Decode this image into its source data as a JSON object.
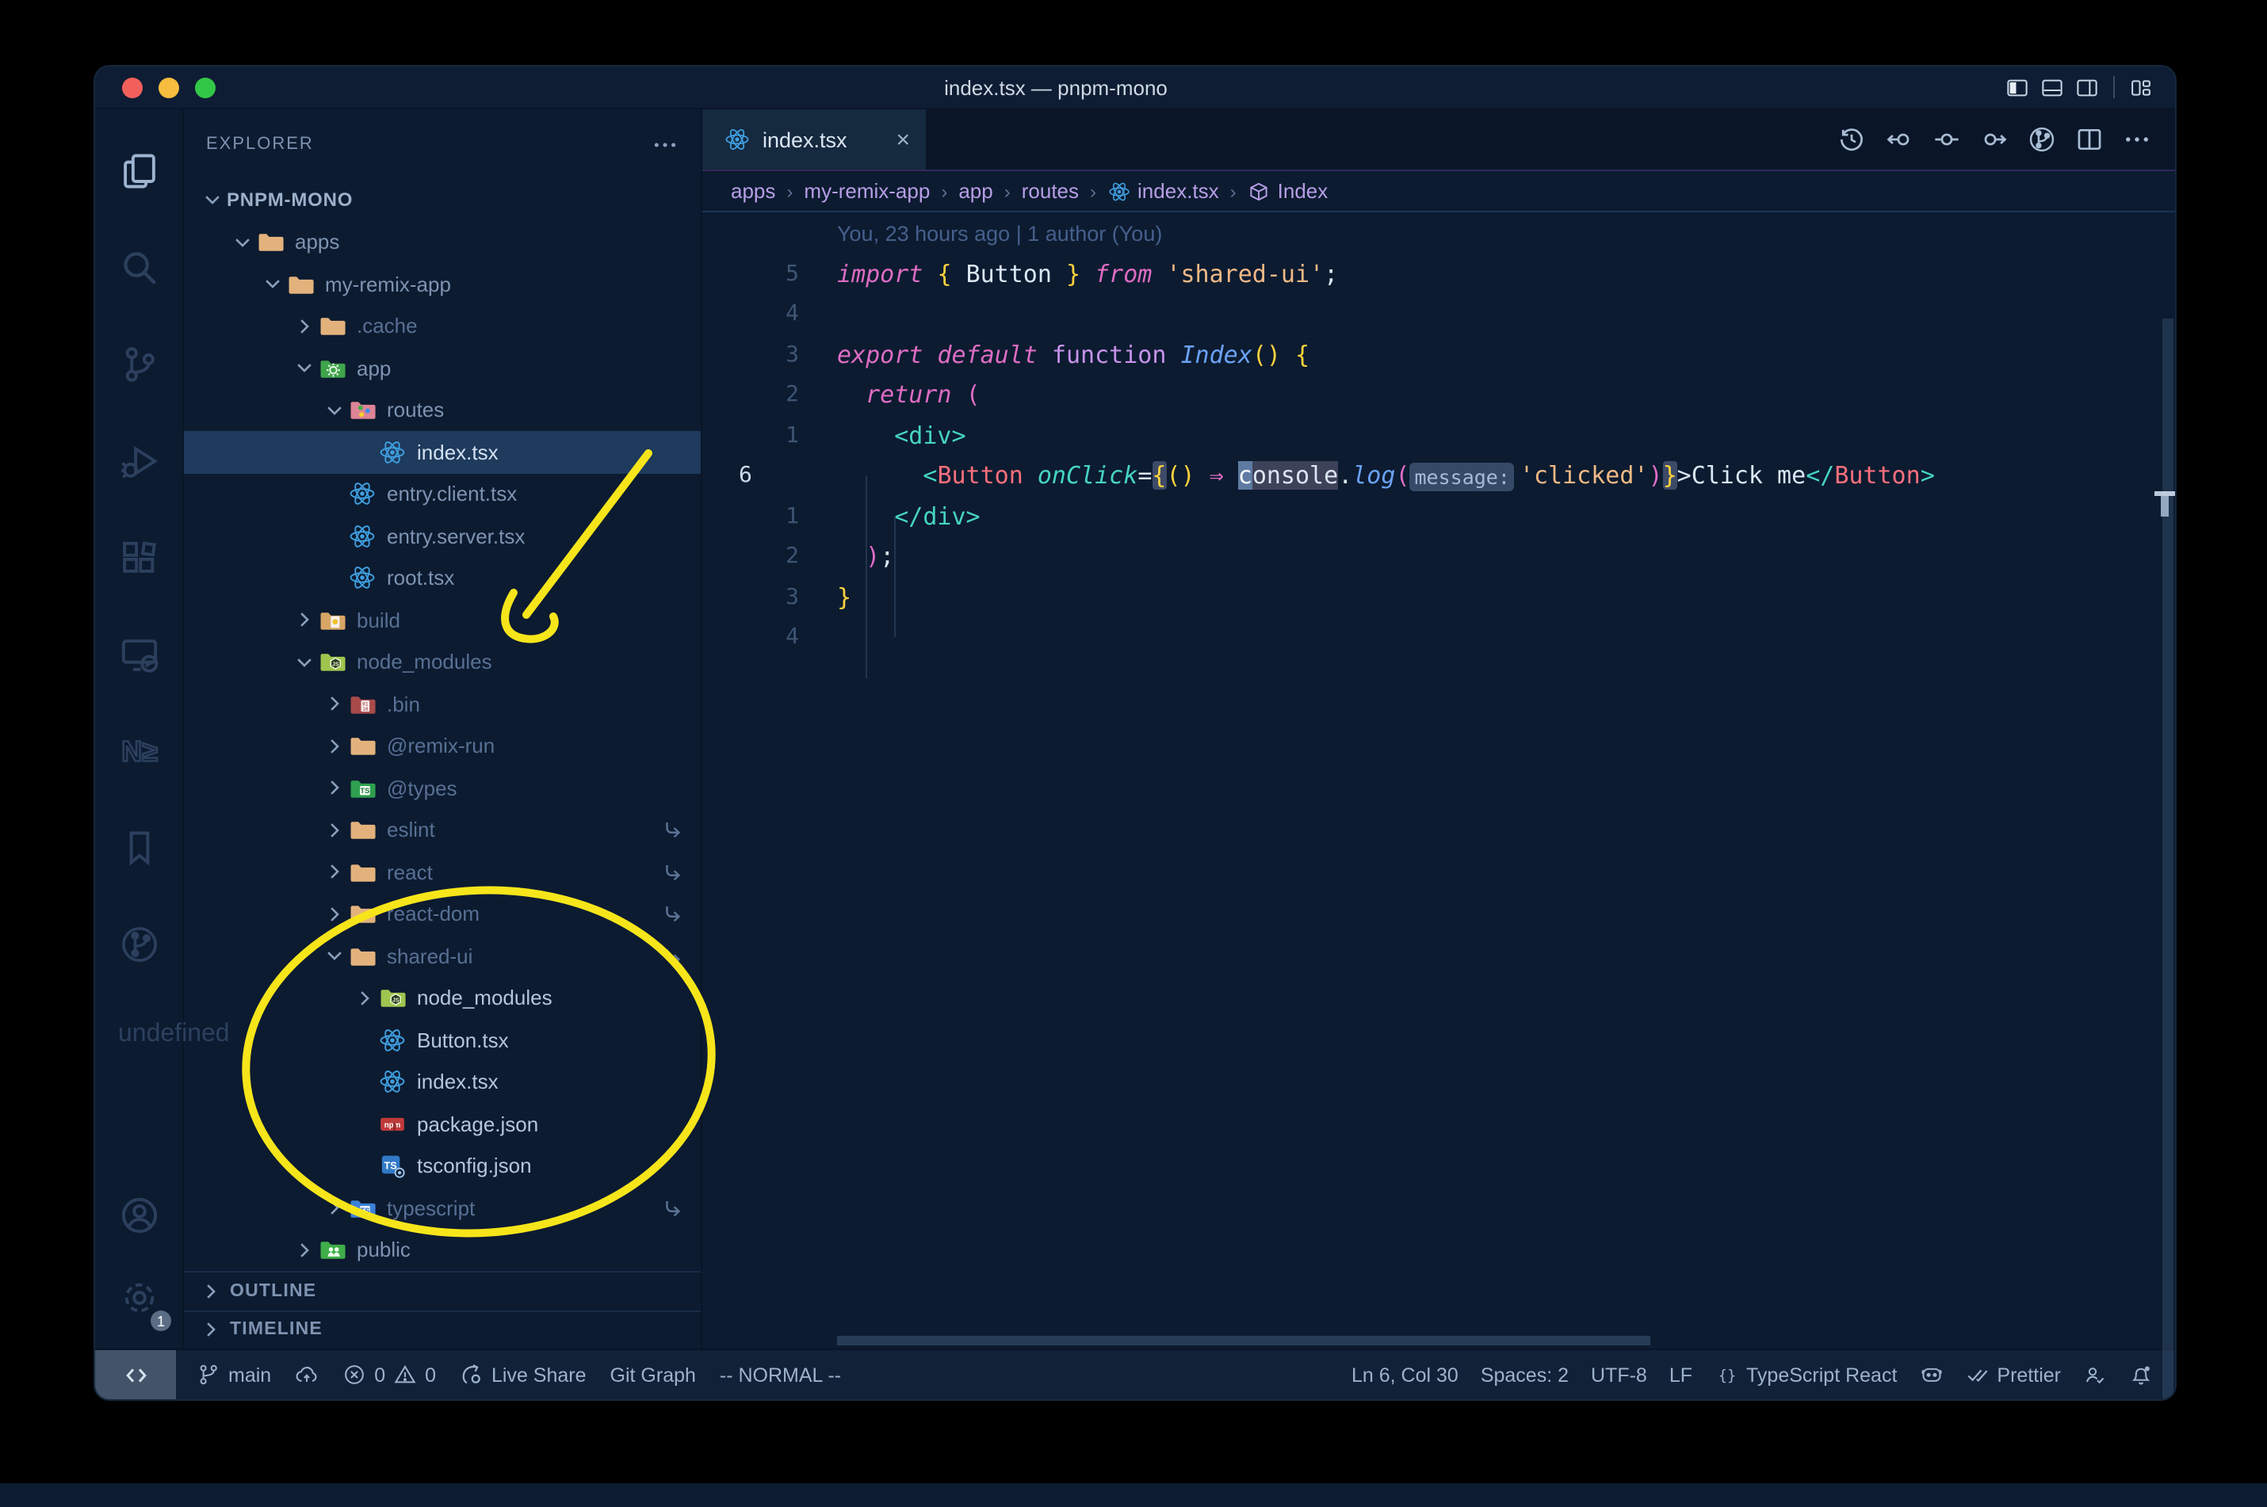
{
  "window": {
    "title": "index.tsx — pnpm-mono"
  },
  "titlebar": {
    "traffic_lights": [
      "close",
      "minimize",
      "zoom"
    ],
    "layout_actions": [
      "toggle-sidebar",
      "toggle-panel",
      "toggle-secondary-sidebar",
      "separator",
      "customize-layout"
    ]
  },
  "activity_bar": {
    "top": [
      {
        "name": "explorer",
        "icon": "files",
        "active": true
      },
      {
        "name": "search",
        "icon": "search",
        "active": false
      },
      {
        "name": "source-control",
        "icon": "scm",
        "active": false
      },
      {
        "name": "run-debug",
        "icon": "debug",
        "active": false
      },
      {
        "name": "extensions",
        "icon": "extensions",
        "active": false
      },
      {
        "name": "remote-explorer",
        "icon": "remote-explorer",
        "active": false
      },
      {
        "name": "nx-console",
        "icon": "nx",
        "active": false
      },
      {
        "name": "bookmarks",
        "icon": "bookmark",
        "active": false
      },
      {
        "name": "git-graph",
        "icon": "graph-circle",
        "active": false
      },
      {
        "name": "more-views",
        "icon": "ellipsis",
        "active": false
      }
    ],
    "bottom": [
      {
        "name": "accounts",
        "icon": "account",
        "badge": ""
      },
      {
        "name": "settings",
        "icon": "gear",
        "badge": "1"
      }
    ]
  },
  "explorer": {
    "header": "EXPLORER",
    "root": {
      "label": "PNPM-MONO",
      "chevron": "down"
    },
    "items": [
      {
        "label": "apps",
        "icon": "folder-tan",
        "level": 1,
        "chevron": "down",
        "tone": "normal"
      },
      {
        "label": "my-remix-app",
        "icon": "folder-tan",
        "level": 2,
        "chevron": "down",
        "tone": "normal"
      },
      {
        "label": ".cache",
        "icon": "folder-tan",
        "level": 3,
        "chevron": "right",
        "tone": "dim"
      },
      {
        "label": "app",
        "icon": "folder-app",
        "level": 3,
        "chevron": "down",
        "tone": "normal"
      },
      {
        "label": "routes",
        "icon": "folder-routes",
        "level": 4,
        "chevron": "down",
        "tone": "normal"
      },
      {
        "label": "index.tsx",
        "icon": "react",
        "level": 5,
        "chevron": null,
        "tone": "bright",
        "selected": true
      },
      {
        "label": "entry.client.tsx",
        "icon": "react",
        "level": 4,
        "chevron": null,
        "tone": "normal"
      },
      {
        "label": "entry.server.tsx",
        "icon": "react",
        "level": 4,
        "chevron": null,
        "tone": "normal"
      },
      {
        "label": "root.tsx",
        "icon": "react",
        "level": 4,
        "chevron": null,
        "tone": "normal"
      },
      {
        "label": "build",
        "icon": "folder-build",
        "level": 3,
        "chevron": "right",
        "tone": "dim"
      },
      {
        "label": "node_modules",
        "icon": "folder-nm",
        "level": 3,
        "chevron": "down",
        "tone": "dim"
      },
      {
        "label": ".bin",
        "icon": "folder-bin",
        "level": 4,
        "chevron": "right",
        "tone": "dim"
      },
      {
        "label": "@remix-run",
        "icon": "folder-tan",
        "level": 4,
        "chevron": "right",
        "tone": "dim"
      },
      {
        "label": "@types",
        "icon": "folder-types",
        "level": 4,
        "chevron": "right",
        "tone": "dim"
      },
      {
        "label": "eslint",
        "icon": "folder-tan",
        "level": 4,
        "chevron": "right",
        "tone": "dim",
        "symlink": true
      },
      {
        "label": "react",
        "icon": "folder-tan",
        "level": 4,
        "chevron": "right",
        "tone": "dim",
        "symlink": true
      },
      {
        "label": "react-dom",
        "icon": "folder-tan",
        "level": 4,
        "chevron": "right",
        "tone": "dim",
        "symlink": true
      },
      {
        "label": "shared-ui",
        "icon": "folder-tan",
        "level": 4,
        "chevron": "down",
        "tone": "dim",
        "symlink": true
      },
      {
        "label": "node_modules",
        "icon": "folder-nm",
        "level": 5,
        "chevron": "right",
        "tone": "bright"
      },
      {
        "label": "Button.tsx",
        "icon": "react",
        "level": 5,
        "chevron": null,
        "tone": "bright"
      },
      {
        "label": "index.tsx",
        "icon": "react",
        "level": 5,
        "chevron": null,
        "tone": "bright"
      },
      {
        "label": "package.json",
        "icon": "npm",
        "level": 5,
        "chevron": null,
        "tone": "bright"
      },
      {
        "label": "tsconfig.json",
        "icon": "tsconfig",
        "level": 5,
        "chevron": null,
        "tone": "bright"
      },
      {
        "label": "typescript",
        "icon": "folder-tsblue",
        "level": 4,
        "chevron": "right",
        "tone": "dim",
        "symlink": true
      },
      {
        "label": "public",
        "icon": "folder-public",
        "level": 3,
        "chevron": "right",
        "tone": "normal"
      }
    ],
    "sections": [
      "OUTLINE",
      "TIMELINE"
    ]
  },
  "tabs": [
    {
      "label": "index.tsx",
      "icon": "react",
      "active": true,
      "close_icon": "×"
    }
  ],
  "editor_actions": [
    "history",
    "nav-back",
    "nav-current",
    "nav-forward",
    "gitlens-graph",
    "split-editor",
    "more-actions"
  ],
  "breadcrumbs": [
    {
      "label": "apps"
    },
    {
      "label": "my-remix-app"
    },
    {
      "label": "app"
    },
    {
      "label": "routes"
    },
    {
      "label": "index.tsx",
      "icon": "react"
    },
    {
      "label": "Index",
      "icon": "symbol-module"
    }
  ],
  "editor": {
    "blame": "You, 23 hours ago | 1 author (You)",
    "lines": [
      {
        "n": "5",
        "active": false,
        "tokens": [
          [
            "import",
            "k"
          ],
          [
            " ",
            ""
          ],
          [
            "{",
            "y"
          ],
          [
            " ",
            ""
          ],
          [
            "Button",
            "w"
          ],
          [
            " ",
            ""
          ],
          [
            "}",
            "y"
          ],
          [
            " ",
            ""
          ],
          [
            "from",
            "k"
          ],
          [
            " ",
            ""
          ],
          [
            "'shared-ui'",
            "s"
          ],
          [
            ";",
            "w"
          ]
        ]
      },
      {
        "n": "4",
        "active": false,
        "tokens": []
      },
      {
        "n": "3",
        "active": false,
        "tokens": [
          [
            "export",
            "k"
          ],
          [
            " ",
            ""
          ],
          [
            "default",
            "k"
          ],
          [
            " ",
            ""
          ],
          [
            "function",
            "k2"
          ],
          [
            " ",
            ""
          ],
          [
            "Index",
            "fn"
          ],
          [
            "(",
            "y"
          ],
          [
            ")",
            "y"
          ],
          [
            " ",
            ""
          ],
          [
            "{",
            "y"
          ]
        ]
      },
      {
        "n": "2",
        "active": false,
        "tokens": [
          [
            "  ",
            ""
          ],
          [
            "return",
            "k"
          ],
          [
            " ",
            ""
          ],
          [
            "(",
            "p"
          ]
        ]
      },
      {
        "n": "1",
        "active": false,
        "tokens": [
          [
            "    ",
            ""
          ],
          [
            "<div>",
            "t"
          ]
        ]
      },
      {
        "n": "6",
        "active": true,
        "tokens": [
          [
            "      ",
            ""
          ],
          [
            "<",
            "t"
          ],
          [
            "Button",
            "tag"
          ],
          [
            " ",
            ""
          ],
          [
            "onClick",
            "attr"
          ],
          [
            "=",
            "w"
          ],
          [
            "{",
            "ybox"
          ],
          [
            "(",
            "y"
          ],
          [
            ")",
            "y"
          ],
          [
            " ",
            ""
          ],
          [
            "⇒",
            "p"
          ],
          [
            " ",
            ""
          ],
          [
            "c",
            "cur"
          ],
          [
            "onsole",
            "hl"
          ],
          [
            ".",
            "w"
          ],
          [
            "log",
            "fn"
          ],
          [
            "(",
            "p"
          ],
          [
            "message:",
            "inlay"
          ],
          [
            "'clicked'",
            "s"
          ],
          [
            ")",
            "p"
          ],
          [
            "}",
            "ybox"
          ],
          [
            ">",
            "w"
          ],
          [
            "Click me",
            "w"
          ],
          [
            "</",
            "t"
          ],
          [
            "Button",
            "tag"
          ],
          [
            ">",
            "t"
          ]
        ]
      },
      {
        "n": "1",
        "active": false,
        "tokens": [
          [
            "    ",
            ""
          ],
          [
            "</div>",
            "t"
          ]
        ]
      },
      {
        "n": "2",
        "active": false,
        "tokens": [
          [
            "  ",
            ""
          ],
          [
            ")",
            "p"
          ],
          [
            ";",
            "w"
          ]
        ]
      },
      {
        "n": "3",
        "active": false,
        "tokens": [
          [
            "}",
            "y"
          ]
        ]
      },
      {
        "n": "4",
        "active": false,
        "tokens": []
      }
    ]
  },
  "status_bar": {
    "left": [
      {
        "name": "remote-indicator",
        "icon": "remote",
        "block": true
      },
      {
        "name": "git-branch",
        "icon": "branch",
        "label": "main"
      },
      {
        "name": "sync",
        "icon": "cloud-up",
        "label": ""
      },
      {
        "name": "problems",
        "composite": [
          [
            "error",
            "0"
          ],
          [
            "warning",
            "0"
          ]
        ]
      },
      {
        "name": "live-share",
        "icon": "liveshare",
        "label": "Live Share"
      },
      {
        "name": "git-graph",
        "label": "Git Graph"
      },
      {
        "name": "vim-mode",
        "label": "-- NORMAL --"
      }
    ],
    "right": [
      {
        "name": "cursor-position",
        "label": "Ln 6, Col 30"
      },
      {
        "name": "indentation",
        "label": "Spaces: 2"
      },
      {
        "name": "encoding",
        "label": "UTF-8"
      },
      {
        "name": "eol",
        "label": "LF"
      },
      {
        "name": "language-mode",
        "icon": "braces",
        "label": "TypeScript React"
      },
      {
        "name": "copilot",
        "icon": "copilot",
        "label": ""
      },
      {
        "name": "prettier",
        "icon": "double-check",
        "label": "Prettier"
      },
      {
        "name": "feedback",
        "icon": "feedback",
        "label": ""
      },
      {
        "name": "notifications",
        "icon": "bell",
        "label": ""
      }
    ]
  },
  "annotation_color": "#f6e51a"
}
